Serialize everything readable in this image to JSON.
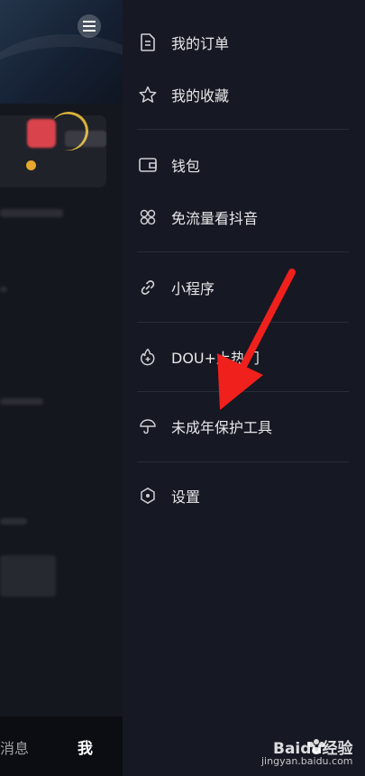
{
  "menu": {
    "items": [
      {
        "label": "我的订单",
        "icon": "order-icon"
      },
      {
        "label": "我的收藏",
        "icon": "star-icon"
      },
      {
        "label": "钱包",
        "icon": "wallet-icon"
      },
      {
        "label": "免流量看抖音",
        "icon": "flower-icon"
      },
      {
        "label": "小程序",
        "icon": "link-icon"
      },
      {
        "label": "DOU+上热门",
        "icon": "dou-plus-icon"
      },
      {
        "label": "未成年保护工具",
        "icon": "umbrella-icon"
      },
      {
        "label": "设置",
        "icon": "settings-icon"
      }
    ]
  },
  "bottom_nav": {
    "messages_label": "消息",
    "me_label": "我"
  },
  "annotation": {
    "arrow_color": "#f0201c"
  },
  "watermark": {
    "brand": "Baidu经验",
    "url": "jingyan.baidu.com"
  }
}
